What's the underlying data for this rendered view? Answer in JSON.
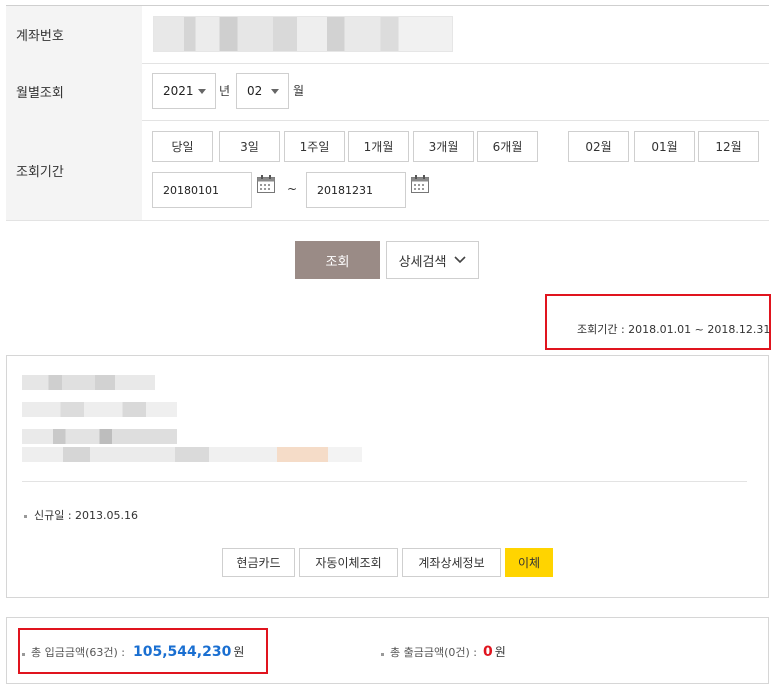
{
  "form": {
    "account_label": "계좌번호",
    "monthly_label": "월별조회",
    "year_value": "2021",
    "year_unit": "년",
    "month_value": "02",
    "month_unit": "월",
    "period_label": "조회기간",
    "period_buttons": [
      "당일",
      "3일",
      "1주일",
      "1개월",
      "3개월",
      "6개월"
    ],
    "month_buttons": [
      "02월",
      "01월",
      "12월"
    ],
    "start_date": "20180101",
    "end_date": "20181231",
    "range_sep": "~"
  },
  "actions": {
    "search_label": "조회",
    "detail_label": "상세검색"
  },
  "period_display": "조회기간 : 2018.01.01 ~ 2018.12.31",
  "account": {
    "new_date_text": "신규일 : 2013.05.16",
    "buttons": [
      "현금카드",
      "자동이체조회",
      "계좌상세정보",
      "이체"
    ]
  },
  "summary": {
    "in_label": "총 입금금액(63건) :",
    "in_amount": "105,544,230",
    "in_unit": "원",
    "out_label": "총 출금금액(0건) :",
    "out_amount": "0",
    "out_unit": "원"
  },
  "colors": {
    "highlight_border": "#e0141e",
    "search_button": "#9a8b86",
    "transfer_button": "#ffd400",
    "in_amount": "#1a6fd1",
    "out_amount": "#e0141e"
  }
}
